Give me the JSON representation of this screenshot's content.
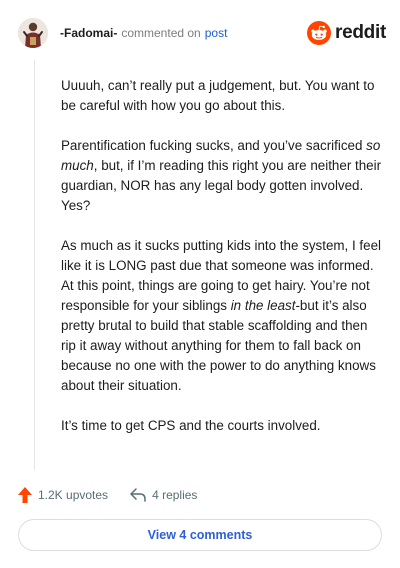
{
  "header": {
    "username": "-Fadomai-",
    "commented_text": "commented on",
    "post_link": "post",
    "brand_word": "reddit"
  },
  "comment": {
    "paragraphs": [
      [
        {
          "t": "Uuuuh, can’t really put a judgement, but. You want to be careful with how you go about this.",
          "i": false
        }
      ],
      [
        {
          "t": "Parentification fucking sucks, and you’ve sacrificed ",
          "i": false
        },
        {
          "t": "so much",
          "i": true
        },
        {
          "t": ", but, if I’m reading this right you are neither their guardian, NOR has any legal body gotten involved. Yes?",
          "i": false
        }
      ],
      [
        {
          "t": "As much as it sucks putting kids into the system, I feel like it is LONG past due that someone was informed. At this point, things are going to get hairy. You’re not responsible for your siblings ",
          "i": false
        },
        {
          "t": "in the least",
          "i": true
        },
        {
          "t": "-but it’s also pretty brutal to build that stable scaffolding and then rip it away without anything for them to fall back on because no one with the power to do anything knows about their situation.",
          "i": false
        }
      ],
      [
        {
          "t": "It’s time to get CPS and the courts involved.",
          "i": false
        }
      ]
    ]
  },
  "footer": {
    "upvotes": "1.2K upvotes",
    "replies": "4 replies",
    "view_button": "View 4 comments"
  },
  "colors": {
    "brand_orange": "#ff4500",
    "link_blue": "#1a5bd6",
    "upvote_orange": "#ff4500"
  }
}
